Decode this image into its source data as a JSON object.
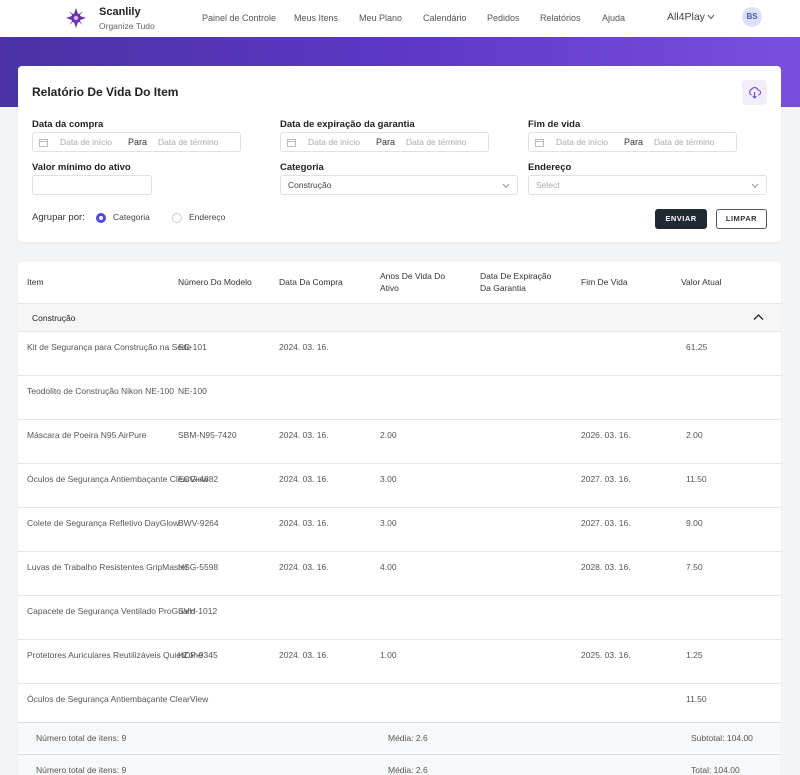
{
  "app": {
    "name": "Scanlily",
    "tagline": "Organize Tudo"
  },
  "nav": [
    "Painel de Controle",
    "Meus Itens",
    "Meu Plano",
    "Calendário",
    "Pedidos",
    "Relatórios",
    "Ajuda"
  ],
  "org": "All4Play",
  "user_initials": "BS",
  "report": {
    "title": "Relatório De Vida Do Item",
    "filters": {
      "purchase_date": {
        "label": "Data da compra",
        "start": "Data de início",
        "sep": "Para",
        "end": "Data de término"
      },
      "warranty_date": {
        "label": "Data de expiração da garantia",
        "start": "Data de início",
        "sep": "Para",
        "end": "Data de término"
      },
      "end_of_life": {
        "label": "Fim de vida",
        "start": "Data de início",
        "sep": "Para",
        "end": "Data de término"
      },
      "min_value": {
        "label": "Valor mínimo do ativo",
        "value": ""
      },
      "category": {
        "label": "Categoria",
        "value": "Construção"
      },
      "address": {
        "label": "Endereço",
        "placeholder": "Select"
      }
    },
    "group_by": {
      "label": "Agrupar por:",
      "options": [
        "Categoria",
        "Endereço"
      ],
      "selected": "Categoria"
    },
    "buttons": {
      "send": "ENVIAR",
      "clear": "LIMPAR"
    }
  },
  "table": {
    "columns": [
      "Item",
      "Número Do Modelo",
      "Data Da Compra",
      "Anos De Vida Do Ativo",
      "Data De Expiração Da Garantia",
      "Fim De Vida",
      "Valor Atual"
    ],
    "group": "Construção",
    "rows": [
      [
        "Kit de Segurança para Construção na Sede",
        "SC-101",
        "2024. 03. 16.",
        "",
        "",
        "",
        "61.25"
      ],
      [
        "Teodolito de Construção Nikon NE-100",
        "NE-100",
        "",
        "",
        "",
        "",
        ""
      ],
      [
        "Máscara de Poeira N95 AirPure",
        "SBM-N95-7420",
        "2024. 03. 16.",
        "2.00",
        "",
        "2026. 03. 16.",
        "2.00"
      ],
      [
        "Óculos de Segurança Antiembaçante ClearView",
        "ECG-4882",
        "2024. 03. 16.",
        "3.00",
        "",
        "2027. 03. 16.",
        "11.50"
      ],
      [
        "Colete de Segurança Refletivo DayGlow",
        "BWV-9264",
        "2024. 03. 16.",
        "3.00",
        "",
        "2027. 03. 16.",
        "9.00"
      ],
      [
        "Luvas de Trabalho Resistentes GripMaster",
        "HSG-5598",
        "2024. 03. 16.",
        "4.00",
        "",
        "2028. 03. 16.",
        "7.50"
      ],
      [
        "Capacete de Segurança Ventilado ProGuard",
        "SVH-1012",
        "",
        "",
        "",
        "",
        ""
      ],
      [
        "Protetores Auriculares Reutilizáveis QuietZone",
        "HCP-9345",
        "2024. 03. 16.",
        "1.00",
        "",
        "2025. 03. 16.",
        "1.25"
      ],
      [
        "Óculos de Segurança Antiembaçante ClearView",
        "",
        "",
        "",
        "",
        "",
        "11.50"
      ]
    ],
    "subtotal": {
      "count": "Número total de itens: 9",
      "avg": "Média: 2.6",
      "sum": "Subtotal: 104.00"
    },
    "total": {
      "count": "Número total de itens: 9",
      "avg": "Média: 2.6",
      "sum": "Total: 104.00"
    }
  }
}
